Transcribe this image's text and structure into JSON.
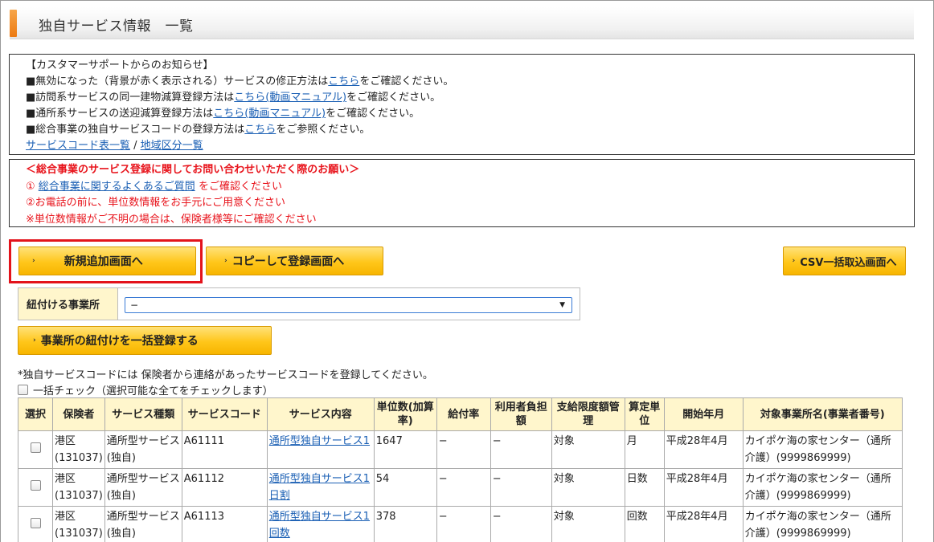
{
  "page_title": "独自サービス情報　一覧",
  "notice": {
    "heading": "【カスタマーサポートからのお知らせ】",
    "lines": [
      {
        "pre": "■無効になった（背景が赤く表示される）サービスの修正方法は",
        "link": "こちら",
        "post": "をご確認ください。"
      },
      {
        "pre": "■訪問系サービスの同一建物減算登録方法は",
        "link": "こちら(動画マニュアル)",
        "post": "をご確認ください。"
      },
      {
        "pre": "■通所系サービスの送迎減算登録方法は",
        "link": "こちら(動画マニュアル)",
        "post": "をご確認ください。"
      },
      {
        "pre": "■総合事業の独自サービスコードの登録方法は",
        "link": "こちら",
        "post": "をご参照ください。"
      }
    ],
    "link_service_code": "サービスコード表一覧",
    "separator": " / ",
    "link_area": "地域区分一覧"
  },
  "request": {
    "heading": "＜総合事業のサービス登録に関してお問い合わせいただく際のお願い＞",
    "line1_pre": "① ",
    "line1_link": "総合事業に関するよくあるご質問",
    "line1_post": " をご確認ください",
    "line2": "②お電話の前に、単位数情報をお手元にご用意ください",
    "line3": "※単位数情報がご不明の場合は、保険者様等にご確認ください"
  },
  "buttons": {
    "new": "新規追加画面へ",
    "copy": "コピーして登録画面へ",
    "csv": "CSV一括取込画面へ",
    "bulk": "事業所の紐付けを一括登録する",
    "arrow": "›"
  },
  "assign": {
    "label": "紐付ける事業所",
    "selected": "−",
    "caret": "▼"
  },
  "note": "*独自サービスコードには 保険者から連絡があったサービスコードを登録してください。",
  "check_all": "一括チェック（選択可能な全てをチェックします）",
  "table": {
    "headers": [
      "選択",
      "保険者",
      "サービス種類",
      "サービスコード",
      "サービス内容",
      "単位数(加算率)",
      "給付率",
      "利用者負担額",
      "支給限度額管理",
      "算定単位",
      "開始年月",
      "対象事業所名(事業者番号)"
    ],
    "rows": [
      {
        "insurer": "港区(131037)",
        "kind": "通所型サービス(独自)",
        "code": "A61111",
        "content": "通所型独自サービス1",
        "units": "1647",
        "rate": "−",
        "burden": "−",
        "limit": "対象",
        "unit": "月",
        "start": "平成28年4月",
        "office": "カイポケ海の家センター（通所介護）(9999869999)"
      },
      {
        "insurer": "港区(131037)",
        "kind": "通所型サービス(独自)",
        "code": "A61112",
        "content": "通所型独自サービス1日割",
        "units": "54",
        "rate": "−",
        "burden": "−",
        "limit": "対象",
        "unit": "日数",
        "start": "平成28年4月",
        "office": "カイポケ海の家センター（通所介護）(9999869999)"
      },
      {
        "insurer": "港区(131037)",
        "kind": "通所型サービス(独自)",
        "code": "A61113",
        "content": "通所型独自サービス1回数",
        "units": "378",
        "rate": "−",
        "burden": "−",
        "limit": "対象",
        "unit": "回数",
        "start": "平成28年4月",
        "office": "カイポケ海の家センター（通所介護）(9999869999)"
      }
    ]
  }
}
